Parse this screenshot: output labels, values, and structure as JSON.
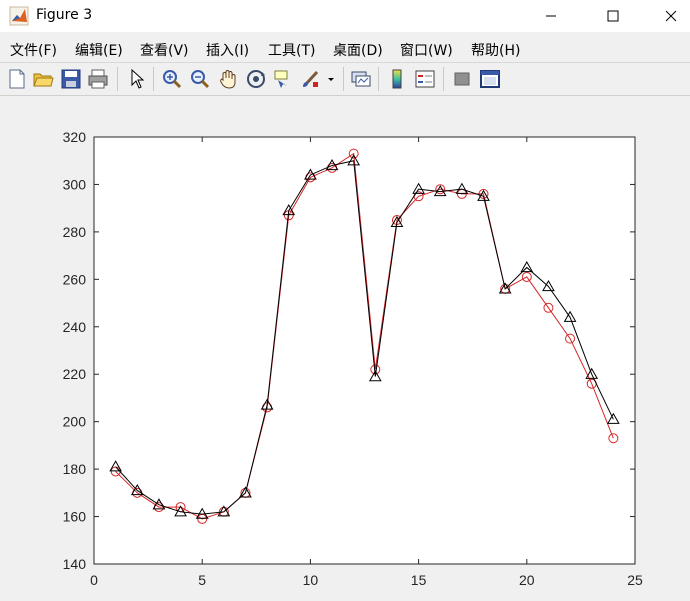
{
  "window": {
    "title": "Figure 3"
  },
  "menu": {
    "items": [
      "文件(F)",
      "编辑(E)",
      "查看(V)",
      "插入(I)",
      "工具(T)",
      "桌面(D)",
      "窗口(W)",
      "帮助(H)"
    ]
  },
  "toolbar": {
    "icons": [
      "new-figure-icon",
      "open-file-icon",
      "save-icon",
      "print-icon",
      "pointer-icon",
      "zoom-in-icon",
      "zoom-out-icon",
      "pan-icon",
      "rotate-3d-icon",
      "data-cursor-icon",
      "brush-icon",
      "link-plot-icon",
      "colorbar-icon",
      "legend-icon",
      "hide-plot-tools-icon",
      "show-plot-tools-icon"
    ]
  },
  "colors": {
    "series_a": "#000000",
    "series_b": "#d62728"
  },
  "chart_data": {
    "type": "line",
    "title": "",
    "xlabel": "",
    "ylabel": "",
    "xlim": [
      0,
      25
    ],
    "ylim": [
      140,
      320
    ],
    "xticks": [
      0,
      5,
      10,
      15,
      20,
      25
    ],
    "yticks": [
      140,
      160,
      180,
      200,
      220,
      240,
      260,
      280,
      300,
      320
    ],
    "grid": false,
    "x": [
      1,
      2,
      3,
      4,
      5,
      6,
      7,
      8,
      9,
      10,
      11,
      12,
      13,
      14,
      15,
      16,
      17,
      18,
      19,
      20,
      21,
      22,
      23,
      24
    ],
    "series": [
      {
        "marker": "triangle",
        "color": "#000000",
        "values": [
          181,
          171,
          165,
          162,
          161,
          162,
          170,
          207,
          289,
          304,
          308,
          310,
          219,
          284,
          298,
          297,
          298,
          295,
          256,
          265,
          257,
          244,
          220,
          201
        ]
      },
      {
        "marker": "circle",
        "color": "#d62728",
        "values": [
          179,
          170,
          164,
          164,
          159,
          162,
          170,
          206,
          287,
          303,
          307,
          313,
          222,
          285,
          295,
          298,
          296,
          296,
          256,
          261,
          248,
          235,
          216,
          193
        ]
      }
    ]
  }
}
